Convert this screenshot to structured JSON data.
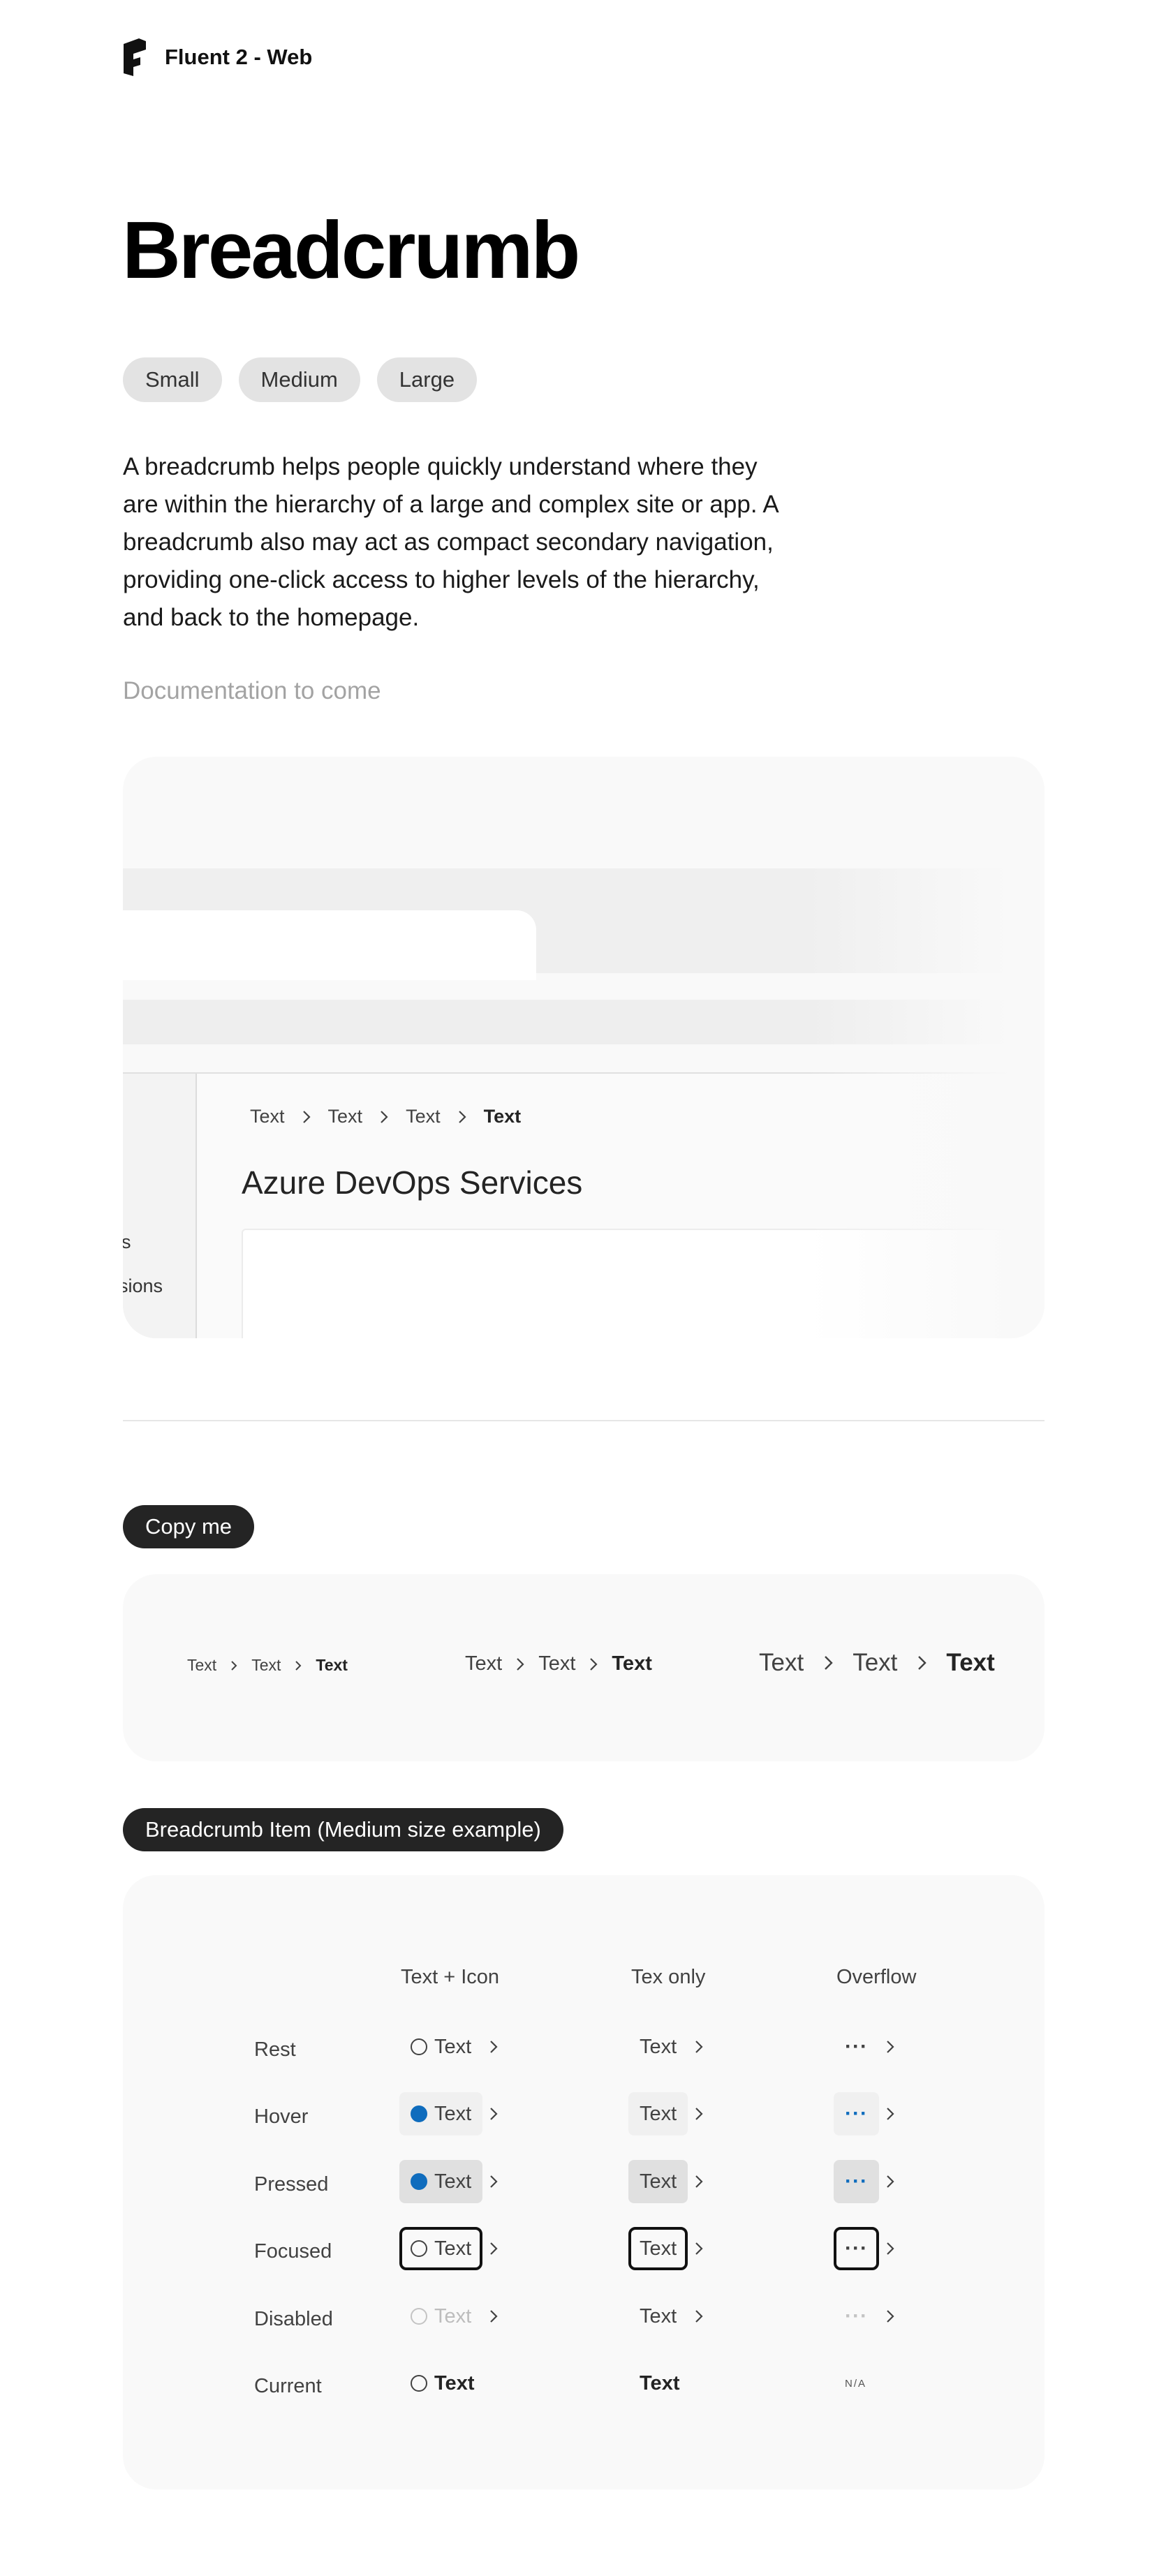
{
  "header": {
    "brand": "Fluent 2 - Web",
    "logo_icon": "fluent-logo-icon"
  },
  "page": {
    "title": "Breadcrumb",
    "sizes": [
      "Small",
      "Medium",
      "Large"
    ],
    "description": "A breadcrumb helps people quickly understand where they are within the hierarchy of a large and complex site or app. A breadcrumb also may act as compact secondary navigation, providing one-click access to higher levels of the hierarchy, and back to the homepage.",
    "doc_note": "Documentation to come"
  },
  "preview": {
    "crumbs": [
      "Text",
      "Text",
      "Text"
    ],
    "current": "Text",
    "heading": "Azure DevOps Services",
    "side_item_1": "s",
    "side_item_2": "sions"
  },
  "copy_section": {
    "tag": "Copy me",
    "small": {
      "items": [
        "Text",
        "Text"
      ],
      "current": "Text"
    },
    "medium": {
      "items": [
        "Text",
        "Text"
      ],
      "current": "Text"
    },
    "large": {
      "items": [
        "Text",
        "Text"
      ],
      "current": "Text"
    }
  },
  "item_section": {
    "tag": "Breadcrumb Item (Medium size example)",
    "columns": [
      "Text + Icon",
      "Tex only",
      "Overflow"
    ],
    "rows": [
      "Rest",
      "Hover",
      "Pressed",
      "Focused",
      "Disabled",
      "Current"
    ],
    "item_text": "Text",
    "overflow_glyph": "···",
    "na": "N/A"
  },
  "colors": {
    "accent": "#0f6cbd",
    "tag_bg": "#242424",
    "card_bg": "#f9f9f9"
  }
}
